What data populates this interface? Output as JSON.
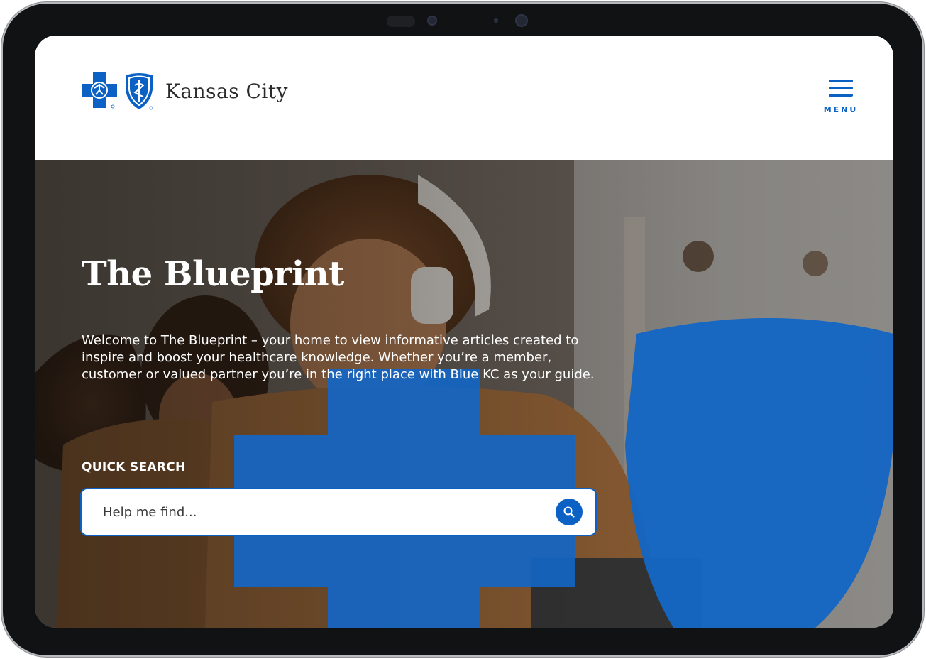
{
  "header": {
    "brand": "Kansas City",
    "menu_label": "MENU"
  },
  "hero": {
    "title": "The Blueprint",
    "intro": "Welcome to The Blueprint – your home to view informative articles created to inspire and boost your healthcare knowledge. Whether you’re a member, customer or valued partner you’re in the right place with Blue KC as your guide."
  },
  "search": {
    "label": "QUICK SEARCH",
    "placeholder": "Help me find..."
  },
  "colors": {
    "brand_blue": "#0b62c4",
    "shape_blue": "#1466c4"
  },
  "icons": {
    "logo_cross": "blue-cross-icon",
    "logo_shield": "blue-shield-icon",
    "menu": "hamburger-icon",
    "search": "search-icon"
  }
}
